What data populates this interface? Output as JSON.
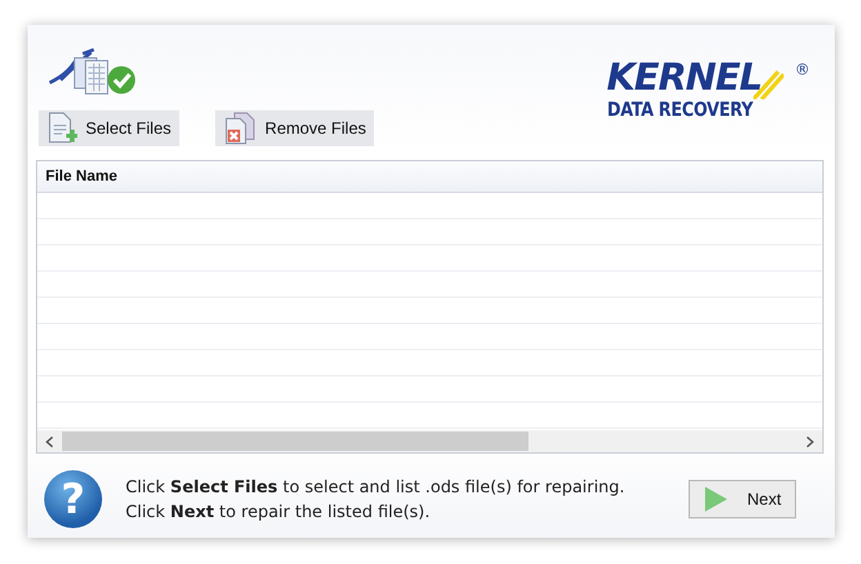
{
  "logo": {
    "wordmark": "KERNEL",
    "registered": "®",
    "tagline": "DATA RECOVERY"
  },
  "toolbar": [
    {
      "label": "Select Files",
      "kind": "add"
    },
    {
      "label": "Remove Files",
      "kind": "remove"
    }
  ],
  "table": {
    "columns": [
      "File Name"
    ]
  },
  "help_glyph": "?",
  "instructions": [
    "Click **Select Files** to select and list .ods file(s) for repairing.",
    "Click **Next** to repair the listed file(s)."
  ],
  "next_button": {
    "label": "Next"
  }
}
